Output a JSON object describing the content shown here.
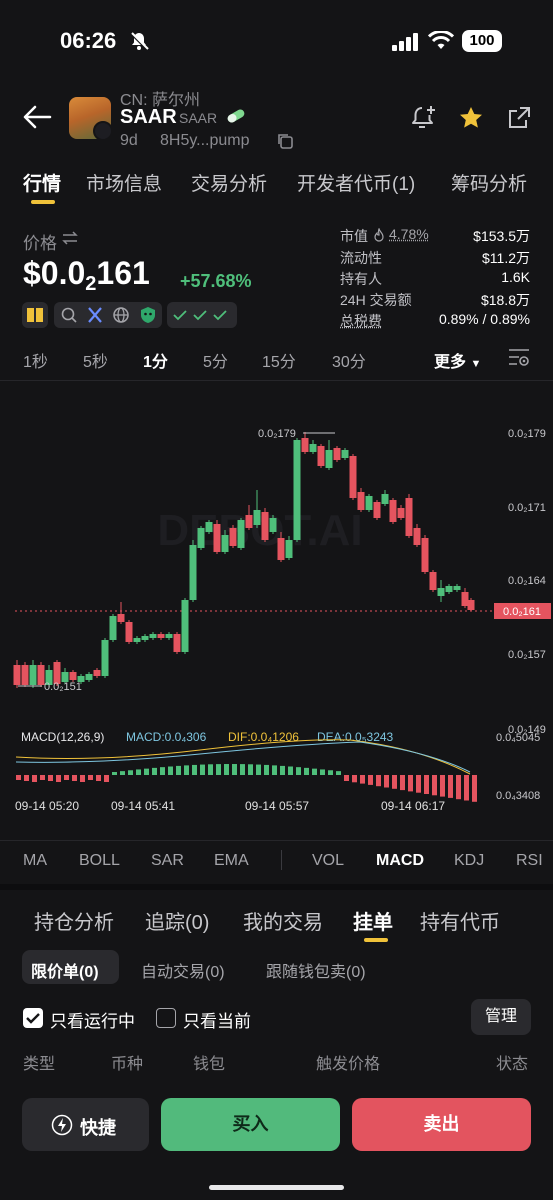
{
  "status_bar": {
    "time": "06:26",
    "battery": "100"
  },
  "token": {
    "cn_name": "CN: 萨尔州",
    "symbol": "SAAR",
    "name_small": "SAAR",
    "age": "9d",
    "address": "8H5y...pump"
  },
  "main_tabs": [
    "行情",
    "市场信息",
    "交易分析",
    "开发者代币(1)",
    "筹码分析"
  ],
  "price": {
    "label": "价格",
    "main": "$0.0",
    "subscript": "2",
    "rest": "161",
    "change": "+57.68%"
  },
  "stats": [
    {
      "label": "市值",
      "extra": "4.78%",
      "value": "$153.5万"
    },
    {
      "label": "流动性",
      "value": "$11.2万"
    },
    {
      "label": "持有人",
      "value": "1.6K"
    },
    {
      "label": "24H 交易额",
      "value": "$18.8万"
    },
    {
      "label": "总税费",
      "value": "0.89% / 0.89%"
    }
  ],
  "timeframes": [
    "1秒",
    "5秒",
    "1分",
    "5分",
    "15分",
    "30分"
  ],
  "more_label": "更多",
  "chart_data": {
    "type": "candlestick",
    "watermark": "DEBOT.AI",
    "price_axis_ticks": [
      "0.0₂179",
      "0.0₂171",
      "0.0₂164",
      "0.0₂157",
      "0.0₂149"
    ],
    "current_price_label": "0.0₂161",
    "high_label": "0.0₂179",
    "low_label": "0.0₂151",
    "x_labels": [
      "09-14 05:20",
      "09-14 05:41",
      "09-14 05:57",
      "09-14 06:17"
    ],
    "macd_title": "MACD(12,26,9)",
    "macd_value": "MACD:0.0₄306",
    "dif_value": "DIF:0.0₄1206",
    "dea_value": "DEA:0.0₅3243",
    "macd_axis_top": "0.0₄5045",
    "macd_axis_bottom": "0.0₄3408"
  },
  "indicators": [
    "MA",
    "BOLL",
    "SAR",
    "EMA",
    "VOL",
    "MACD",
    "KDJ",
    "RSI"
  ],
  "sub_tabs": [
    "持仓分析",
    "追踪(0)",
    "我的交易",
    "挂单",
    "持有代币"
  ],
  "order_types": [
    "限价单(0)",
    "自动交易(0)",
    "跟随钱包卖(0)"
  ],
  "filters": {
    "running": "只看运行中",
    "current": "只看当前",
    "manage": "管理"
  },
  "columns": [
    "类型",
    "币种",
    "钱包",
    "触发价格",
    "状态"
  ],
  "actions": {
    "quick": "快捷",
    "buy": "买入",
    "sell": "卖出"
  },
  "colors": {
    "up": "#4fbf7b",
    "down": "#e5545f",
    "accent": "#f0c23a"
  }
}
